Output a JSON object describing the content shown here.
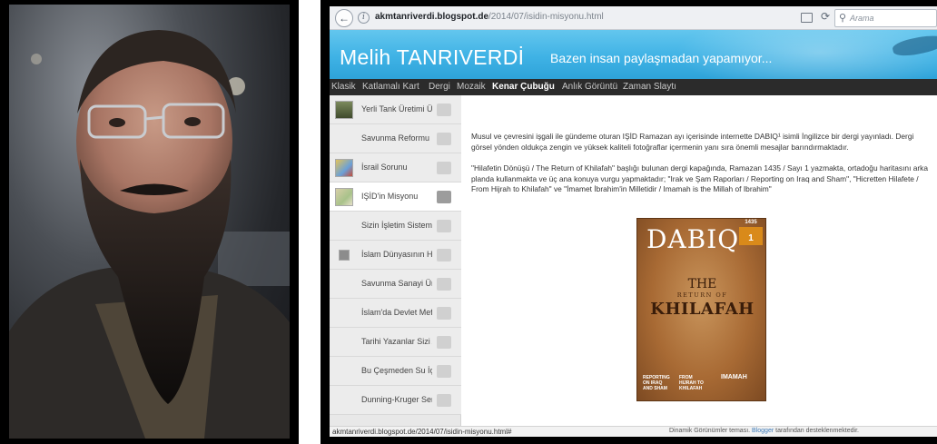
{
  "browser": {
    "url_domain": "akmtanriverdi.blogspot.de",
    "url_path": "/2014/07/isidin-misyonu.html",
    "search_placeholder": "Arama"
  },
  "blog": {
    "title": "Melih TANRIVERDİ",
    "description": "Bazen insan paylaşmadan yapamıyor..."
  },
  "nav": {
    "items": [
      {
        "label": "Klasik",
        "active": false
      },
      {
        "label": "Katlamalı Kart",
        "active": false
      },
      {
        "label": "Dergi",
        "active": false
      },
      {
        "label": "Mozaik",
        "active": false
      },
      {
        "label": "Kenar Çubuğu",
        "active": true
      },
      {
        "label": "Anlık Görüntü",
        "active": false
      },
      {
        "label": "Zaman Slaytı",
        "active": false
      }
    ]
  },
  "sidebar": {
    "items": [
      {
        "title": "Yerli Tank Üretimi Üze",
        "thumb": "tank-thumb"
      },
      {
        "title": "Savunma Reformu R",
        "thumb": ""
      },
      {
        "title": "İsrail Sorunu",
        "thumb": "map-thumb"
      },
      {
        "title": "IŞİD'in Misyonu",
        "thumb": "map-thumb",
        "active": true
      },
      {
        "title": "Sizin İşletim Sisteminiz",
        "thumb": ""
      },
      {
        "title": "İslam Dünyasının Ha",
        "thumb": "doc-thumb"
      },
      {
        "title": "Savunma Sanayi Üre",
        "thumb": ""
      },
      {
        "title": "İslam'da Devlet Mefh",
        "thumb": ""
      },
      {
        "title": "Tarihi Yazanlar Sizi Al",
        "thumb": ""
      },
      {
        "title": "Bu Çeşmeden Su İçi",
        "thumb": ""
      },
      {
        "title": "Dunning-Kruger Send",
        "thumb": ""
      }
    ]
  },
  "article": {
    "paragraph1": "Musul ve çevresini işgali ile gündeme oturan IŞİD Ramazan ayı içerisinde internette DABIQ¹ isimli İngilizce bir dergi yayınladı. Dergi görsel yönden oldukça zengin ve yüksek kaliteli fotoğraflar içermenin yanı sıra önemli mesajlar barındırmaktadır.",
    "paragraph2": "\"Hilafetin Dönüşü / The Return of Khilafah\" başlığı bulunan dergi kapağında, Ramazan 1435 / Sayı 1 yazmakta, ortadoğu haritasını arka planda kullanmakta ve üç ana konuya vurgu yapmaktadır; \"Irak ve Şam Raporları / Reporting on Iraq and Sham\", \"Hicretten Hilafete / From Hijrah to Khilafah\" ve \"İmamet İbrahim'in Milletidir / Imamah is the Millah of Ibrahim\""
  },
  "cover": {
    "masthead": "DABIQ",
    "issue_year": "1435",
    "issue_number": "1",
    "the": "THE",
    "subtitle": "RETURN OF",
    "headline": "KHILAFAH",
    "foot1": "REPORTING ON IRAQ AND SHAM",
    "foot2": "FROM HIJRAH TO KHILAFAH",
    "foot3": "IMAMAH"
  },
  "status": {
    "link_url": "akmtanriverdi.blogspot.de/2014/07/isidin-misyonu.html#",
    "footer_prefix": "Dinamik Görünümler teması.",
    "footer_link": "Blogger",
    "footer_suffix": "tarafından desteklenmektedir."
  },
  "colors": {
    "header_blue": "#3fb2e5",
    "nav_dark": "#2b2b2b",
    "cover_brown": "#a86a34"
  }
}
